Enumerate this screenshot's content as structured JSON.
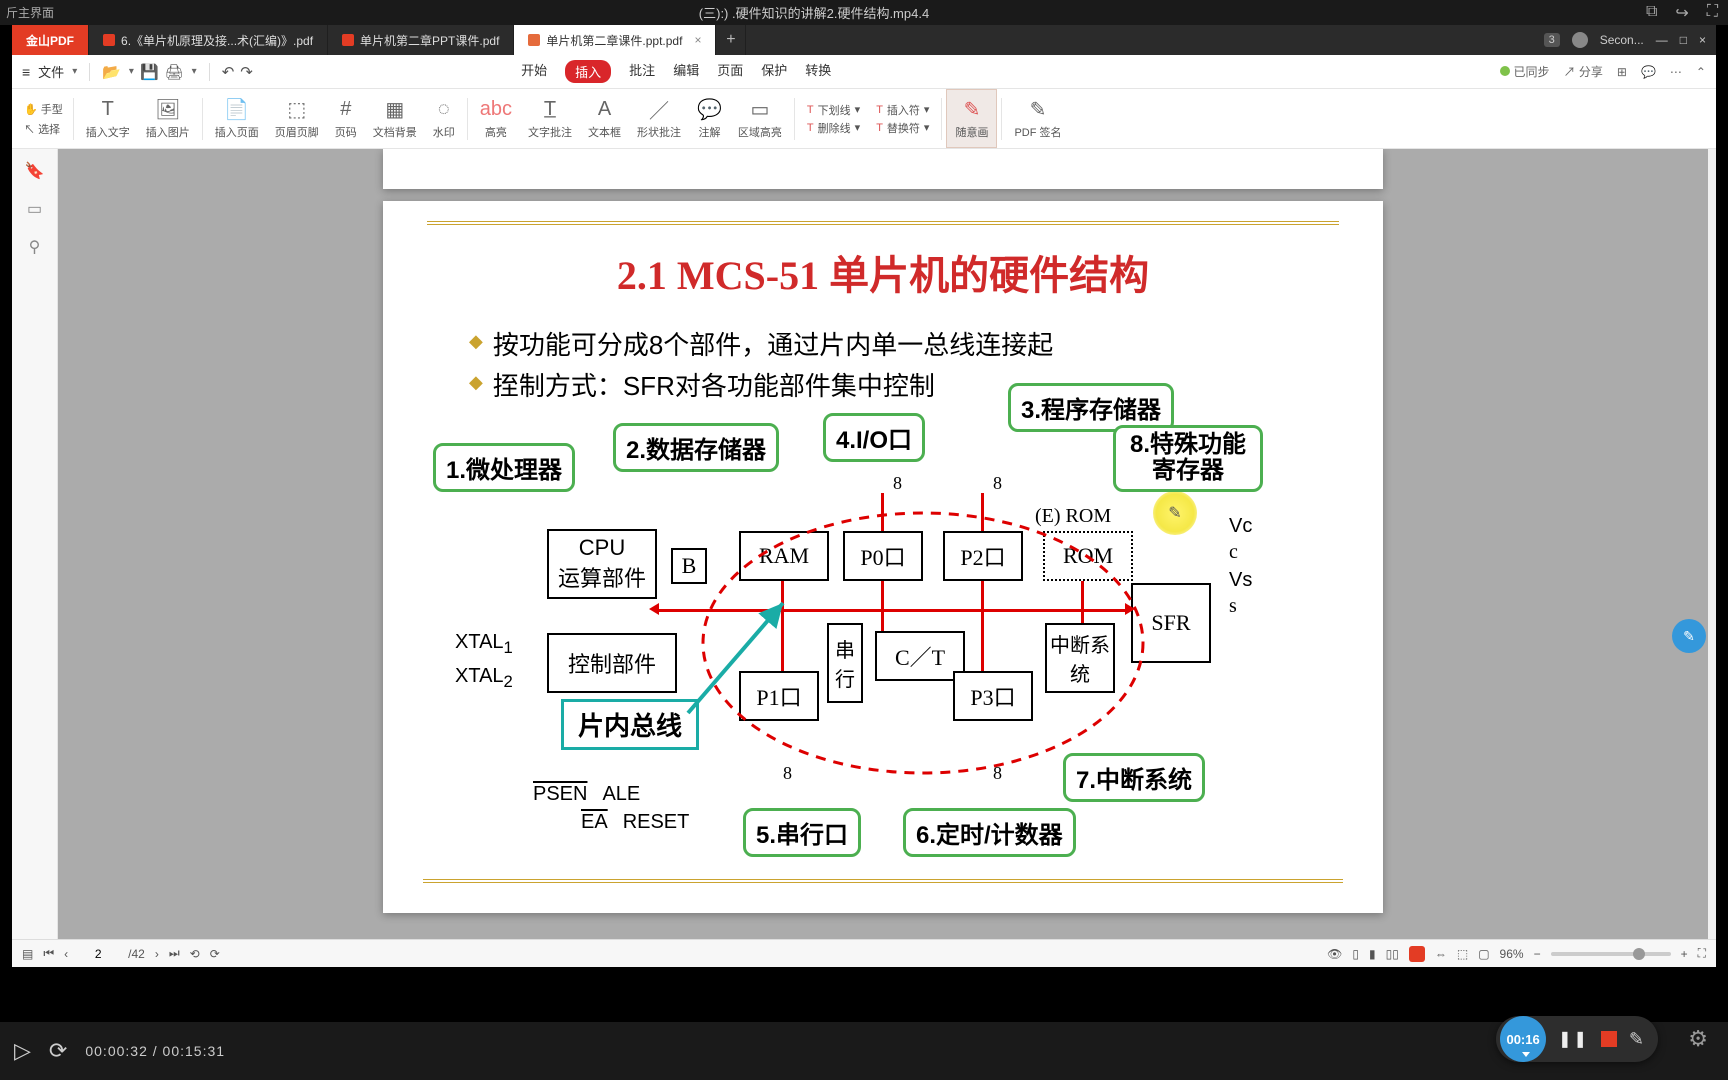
{
  "player": {
    "top_left": "斤主界面",
    "title": "(三):) .硬件知识的讲解2.硬件结构.mp4.4",
    "icons": [
      "pip-icon",
      "forward-icon",
      "expand-icon"
    ]
  },
  "app": {
    "brand": "金山PDF",
    "tabs": [
      {
        "label": "6.《单片机原理及接...术(汇编)》.pdf",
        "active": false
      },
      {
        "label": "单片机第二章PPT课件.pdf",
        "active": false
      },
      {
        "label": "单片机第二章课件.ppt.pdf",
        "active": true
      }
    ],
    "win_badge": "3",
    "win_user": "Secon...",
    "file_label": "文件",
    "menus": [
      "开始",
      "插入",
      "批注",
      "编辑",
      "页面",
      "保护",
      "转换"
    ],
    "menu_active": "插入",
    "sync": "已同步",
    "share": "分享"
  },
  "ribbon_left": [
    {
      "id": "hand",
      "icon": "✋",
      "label": "手型"
    },
    {
      "id": "select",
      "icon": "↖",
      "label": "选择"
    }
  ],
  "ribbon": [
    {
      "id": "ins-text",
      "icon": "T",
      "label": "插入文字"
    },
    {
      "id": "ins-image",
      "icon": "🖼",
      "label": "插入图片"
    },
    {
      "id": "ins-page",
      "icon": "📄",
      "label": "插入页面"
    },
    {
      "id": "header-footer",
      "icon": "⬚",
      "label": "页眉页脚"
    },
    {
      "id": "page-num",
      "icon": "#",
      "label": "页码"
    },
    {
      "id": "doc-bg",
      "icon": "▦",
      "label": "文档背景"
    },
    {
      "id": "watermark",
      "icon": "◌",
      "label": "水印"
    },
    {
      "id": "highlight",
      "icon": "abc",
      "label": "高亮"
    },
    {
      "id": "text-annot",
      "icon": "T̲",
      "label": "文字批注"
    },
    {
      "id": "textbox",
      "icon": "A",
      "label": "文本框"
    },
    {
      "id": "shape-annot",
      "icon": "／",
      "label": "形状批注"
    },
    {
      "id": "annot",
      "icon": "💬",
      "label": "注解"
    },
    {
      "id": "area-hl",
      "icon": "▭",
      "label": "区域高亮"
    }
  ],
  "ribbon_stack": [
    {
      "id": "underline",
      "icon": "T",
      "label": "下划线"
    },
    {
      "id": "strike",
      "icon": "T",
      "label": "删除线"
    },
    {
      "id": "ins-sym",
      "icon": "T",
      "label": "插入符"
    },
    {
      "id": "replace",
      "icon": "T",
      "label": "替换符"
    }
  ],
  "ribbon_right": [
    {
      "id": "freedraw",
      "icon": "✎",
      "label": "随意画",
      "active": true
    },
    {
      "id": "pdf-sign",
      "icon": "✎",
      "label": "PDF 签名"
    }
  ],
  "slide": {
    "title": "2.1 MCS-51 单片机的硬件结构",
    "bullets": [
      "按功能可分成8个部件，通过片内单一总线连接起",
      "挃制方式：SFR对各功能部件集中控制"
    ],
    "callouts": {
      "c1": "1.微处理器",
      "c2": "2.数据存储器",
      "c3": "3.程序存储器",
      "c4": "4.I/O口",
      "c5": "5.串行口",
      "c6": "6.定时/计数器",
      "c7": "7.中断系统",
      "c8": "8.特殊功能寄存器"
    },
    "boxes": {
      "cpu_top": "CPU",
      "cpu_bot": "运算部件",
      "ctrl": "控制部件",
      "b": "B",
      "ram": "RAM",
      "p0": "P0口",
      "p2": "P2口",
      "rom": "ROM",
      "p1": "P1口",
      "ser": "串行",
      "ct": "C／T",
      "p3": "P3口",
      "intc": "中断系统",
      "sfr": "SFR",
      "erom": "(E)  ROM"
    },
    "labels": {
      "xtal1": "XTAL",
      "xtal2": "XTAL",
      "sub1": "1",
      "sub2": "2",
      "psen": "PSEN",
      "ale": "ALE",
      "ea": "EA",
      "reset": "RESET",
      "vc": "Vc",
      "c": "c",
      "vs": "Vs",
      "s": "s",
      "eight": "8",
      "bus": "片内总线"
    }
  },
  "status": {
    "page_cur": "2",
    "page_total": "/42",
    "zoom": "96%"
  },
  "video": {
    "elapsed": "00:00:32",
    "total": "00:15:31"
  },
  "rec": {
    "time": "00:16"
  }
}
